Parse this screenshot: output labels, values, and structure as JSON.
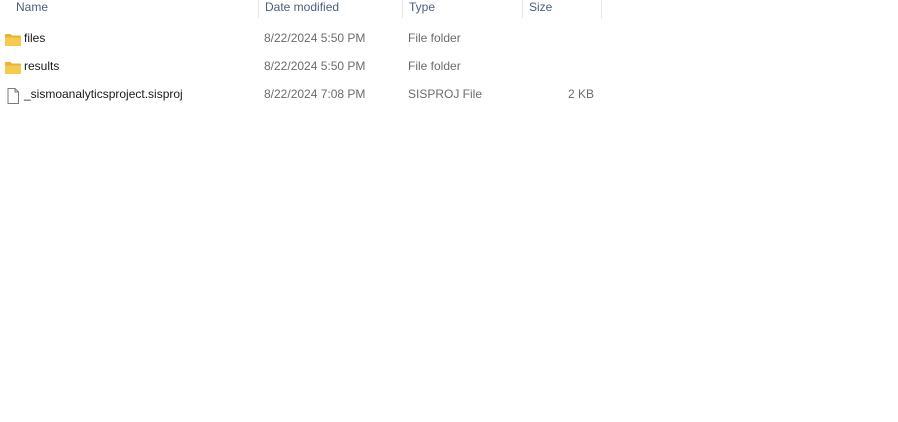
{
  "columns": {
    "name": "Name",
    "date_modified": "Date modified",
    "type": "Type",
    "size": "Size"
  },
  "files": [
    {
      "name": "files",
      "date_modified": "8/22/2024 5:50 PM",
      "type": "File folder",
      "size": "",
      "icon": "folder-icon"
    },
    {
      "name": "results",
      "date_modified": "8/22/2024 5:50 PM",
      "type": "File folder",
      "size": "",
      "icon": "folder-icon"
    },
    {
      "name": "_sismoanalyticsproject.sisproj",
      "date_modified": "8/22/2024 7:08 PM",
      "type": "SISPROJ File",
      "size": "2 KB",
      "icon": "file-icon"
    }
  ],
  "colors": {
    "header_text": "#4c607a",
    "folder": "#f4c542",
    "secondary_text": "#6b6b6b"
  }
}
